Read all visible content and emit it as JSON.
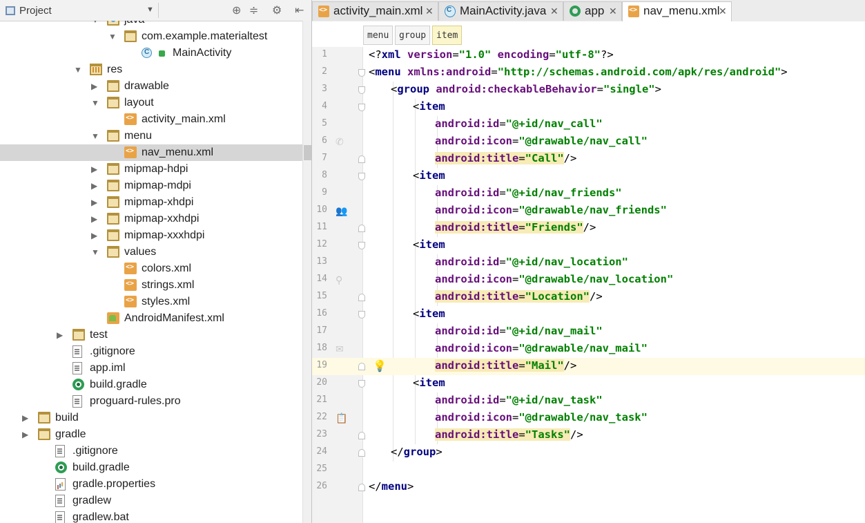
{
  "project_panel": {
    "title": "Project",
    "dropdown_glyph": "▼",
    "header_icons": [
      "⊕",
      "≑",
      "⚙",
      "⇤"
    ],
    "tree": [
      {
        "label": "java",
        "indent": 5,
        "arrow": "▼",
        "icon": "folder-src"
      },
      {
        "label": "com.example.materialtest",
        "indent": 6,
        "arrow": "▼",
        "icon": "folder"
      },
      {
        "label": "MainActivity",
        "indent": 7,
        "arrow": "",
        "icon": "class"
      },
      {
        "label": "res",
        "indent": 4,
        "arrow": "▼",
        "icon": "res"
      },
      {
        "label": "drawable",
        "indent": 5,
        "arrow": "▶",
        "icon": "folder"
      },
      {
        "label": "layout",
        "indent": 5,
        "arrow": "▼",
        "icon": "folder"
      },
      {
        "label": "activity_main.xml",
        "indent": 6,
        "arrow": "",
        "icon": "xml"
      },
      {
        "label": "menu",
        "indent": 5,
        "arrow": "▼",
        "icon": "folder"
      },
      {
        "label": "nav_menu.xml",
        "indent": 6,
        "arrow": "",
        "icon": "xml",
        "selected": true
      },
      {
        "label": "mipmap-hdpi",
        "indent": 5,
        "arrow": "▶",
        "icon": "folder"
      },
      {
        "label": "mipmap-mdpi",
        "indent": 5,
        "arrow": "▶",
        "icon": "folder"
      },
      {
        "label": "mipmap-xhdpi",
        "indent": 5,
        "arrow": "▶",
        "icon": "folder"
      },
      {
        "label": "mipmap-xxhdpi",
        "indent": 5,
        "arrow": "▶",
        "icon": "folder"
      },
      {
        "label": "mipmap-xxxhdpi",
        "indent": 5,
        "arrow": "▶",
        "icon": "folder"
      },
      {
        "label": "values",
        "indent": 5,
        "arrow": "▼",
        "icon": "folder"
      },
      {
        "label": "colors.xml",
        "indent": 6,
        "arrow": "",
        "icon": "xml"
      },
      {
        "label": "strings.xml",
        "indent": 6,
        "arrow": "",
        "icon": "xml"
      },
      {
        "label": "styles.xml",
        "indent": 6,
        "arrow": "",
        "icon": "xml"
      },
      {
        "label": "AndroidManifest.xml",
        "indent": 5,
        "arrow": "",
        "icon": "manifest"
      },
      {
        "label": "test",
        "indent": 3,
        "arrow": "▶",
        "icon": "folder"
      },
      {
        "label": ".gitignore",
        "indent": 3,
        "arrow": "",
        "icon": "file"
      },
      {
        "label": "app.iml",
        "indent": 3,
        "arrow": "",
        "icon": "file"
      },
      {
        "label": "build.gradle",
        "indent": 3,
        "arrow": "",
        "icon": "gradle"
      },
      {
        "label": "proguard-rules.pro",
        "indent": 3,
        "arrow": "",
        "icon": "file"
      },
      {
        "label": "build",
        "indent": 1,
        "arrow": "▶",
        "icon": "folder"
      },
      {
        "label": "gradle",
        "indent": 1,
        "arrow": "▶",
        "icon": "folder"
      },
      {
        "label": ".gitignore",
        "indent": 2,
        "arrow": "",
        "icon": "file"
      },
      {
        "label": "build.gradle",
        "indent": 2,
        "arrow": "",
        "icon": "gradle"
      },
      {
        "label": "gradle.properties",
        "indent": 2,
        "arrow": "",
        "icon": "props"
      },
      {
        "label": "gradlew",
        "indent": 2,
        "arrow": "",
        "icon": "file"
      },
      {
        "label": "gradlew.bat",
        "indent": 2,
        "arrow": "",
        "icon": "file"
      }
    ]
  },
  "editor": {
    "tabs": [
      {
        "label": "activity_main.xml",
        "icon": "xml",
        "active": false
      },
      {
        "label": "MainActivity.java",
        "icon": "class",
        "active": false
      },
      {
        "label": "app",
        "icon": "app",
        "active": false
      },
      {
        "label": "nav_menu.xml",
        "icon": "xml",
        "active": true
      }
    ],
    "close_glyph": "✕",
    "breadcrumbs": [
      {
        "label": "menu",
        "active": false
      },
      {
        "label": "group",
        "active": false
      },
      {
        "label": "item",
        "active": true
      }
    ],
    "current_line": 19,
    "lines": [
      {
        "n": "1",
        "indent": 0,
        "parts": [
          [
            "pi",
            "<?"
          ],
          [
            "tag",
            "xml "
          ],
          [
            "attr",
            "version"
          ],
          [
            "pi",
            "="
          ],
          [
            "val",
            "\"1.0\" "
          ],
          [
            "attr",
            "encoding"
          ],
          [
            "pi",
            "="
          ],
          [
            "val",
            "\"utf-8\""
          ],
          [
            "pi",
            "?>"
          ]
        ]
      },
      {
        "n": "2",
        "indent": 0,
        "fold": "open",
        "parts": [
          [
            "pi",
            "<"
          ],
          [
            "tag",
            "menu "
          ],
          [
            "attr",
            "xmlns:android"
          ],
          [
            "pi",
            "="
          ],
          [
            "val",
            "\"http://schemas.android.com/apk/res/android\""
          ],
          [
            "pi",
            ">"
          ]
        ]
      },
      {
        "n": "3",
        "indent": 1,
        "fold": "open",
        "parts": [
          [
            "pi",
            "<"
          ],
          [
            "tag",
            "group "
          ],
          [
            "attr",
            "android:checkableBehavior"
          ],
          [
            "pi",
            "="
          ],
          [
            "val",
            "\"single\""
          ],
          [
            "pi",
            ">"
          ]
        ]
      },
      {
        "n": "4",
        "indent": 2,
        "fold": "open",
        "parts": [
          [
            "pi",
            "<"
          ],
          [
            "tag",
            "item"
          ]
        ]
      },
      {
        "n": "5",
        "indent": 3,
        "parts": [
          [
            "attr",
            "android:id"
          ],
          [
            "pi",
            "="
          ],
          [
            "val",
            "\"@+id/nav_call\""
          ]
        ]
      },
      {
        "n": "6",
        "indent": 3,
        "gicon": "phone-icon",
        "gicon_glyph": "✆",
        "parts": [
          [
            "attr",
            "android:icon"
          ],
          [
            "pi",
            "="
          ],
          [
            "val",
            "\"@drawable/nav_call\""
          ]
        ]
      },
      {
        "n": "7",
        "indent": 3,
        "fold": "close",
        "parts": [
          [
            "attr hl",
            "android:title"
          ],
          [
            "pi hl",
            "="
          ],
          [
            "val hl",
            "\"Call\""
          ],
          [
            "pi",
            "/>"
          ]
        ]
      },
      {
        "n": "8",
        "indent": 2,
        "fold": "open",
        "parts": [
          [
            "pi",
            "<"
          ],
          [
            "tag",
            "item"
          ]
        ]
      },
      {
        "n": "9",
        "indent": 3,
        "parts": [
          [
            "attr",
            "android:id"
          ],
          [
            "pi",
            "="
          ],
          [
            "val",
            "\"@+id/nav_friends\""
          ]
        ]
      },
      {
        "n": "10",
        "indent": 3,
        "gicon": "people-icon",
        "gicon_glyph": "👥",
        "parts": [
          [
            "attr",
            "android:icon"
          ],
          [
            "pi",
            "="
          ],
          [
            "val",
            "\"@drawable/nav_friends\""
          ]
        ]
      },
      {
        "n": "11",
        "indent": 3,
        "fold": "close",
        "parts": [
          [
            "attr hl",
            "android:title"
          ],
          [
            "pi hl",
            "="
          ],
          [
            "val hl",
            "\"Friends\""
          ],
          [
            "pi",
            "/>"
          ]
        ]
      },
      {
        "n": "12",
        "indent": 2,
        "fold": "open",
        "parts": [
          [
            "pi",
            "<"
          ],
          [
            "tag",
            "item"
          ]
        ]
      },
      {
        "n": "13",
        "indent": 3,
        "parts": [
          [
            "attr",
            "android:id"
          ],
          [
            "pi",
            "="
          ],
          [
            "val",
            "\"@+id/nav_location\""
          ]
        ]
      },
      {
        "n": "14",
        "indent": 3,
        "gicon": "location-pin-icon",
        "gicon_glyph": "⚲",
        "parts": [
          [
            "attr",
            "android:icon"
          ],
          [
            "pi",
            "="
          ],
          [
            "val",
            "\"@drawable/nav_location\""
          ]
        ]
      },
      {
        "n": "15",
        "indent": 3,
        "fold": "close",
        "parts": [
          [
            "attr hl",
            "android:title"
          ],
          [
            "pi hl",
            "="
          ],
          [
            "val hl",
            "\"Location\""
          ],
          [
            "pi",
            "/>"
          ]
        ]
      },
      {
        "n": "16",
        "indent": 2,
        "fold": "open",
        "parts": [
          [
            "pi",
            "<"
          ],
          [
            "tag",
            "item"
          ]
        ]
      },
      {
        "n": "17",
        "indent": 3,
        "parts": [
          [
            "attr",
            "android:id"
          ],
          [
            "pi",
            "="
          ],
          [
            "val",
            "\"@+id/nav_mail\""
          ]
        ]
      },
      {
        "n": "18",
        "indent": 3,
        "gicon": "mail-icon",
        "gicon_glyph": "✉",
        "parts": [
          [
            "attr",
            "android:icon"
          ],
          [
            "pi",
            "="
          ],
          [
            "val",
            "\"@drawable/nav_mail\""
          ]
        ]
      },
      {
        "n": "19",
        "indent": 3,
        "fold": "close",
        "gicon": "lightbulb-icon",
        "gicon_glyph": "💡",
        "parts": [
          [
            "attr hl",
            "android:title"
          ],
          [
            "pi hl",
            "="
          ],
          [
            "val hl",
            "\"Mail\""
          ],
          [
            "pi",
            "/>"
          ]
        ]
      },
      {
        "n": "20",
        "indent": 2,
        "fold": "open",
        "parts": [
          [
            "pi",
            "<"
          ],
          [
            "tag",
            "item"
          ]
        ]
      },
      {
        "n": "21",
        "indent": 3,
        "parts": [
          [
            "attr",
            "android:id"
          ],
          [
            "pi",
            "="
          ],
          [
            "val",
            "\"@+id/nav_task\""
          ]
        ]
      },
      {
        "n": "22",
        "indent": 3,
        "gicon": "clipboard-icon",
        "gicon_glyph": "📋",
        "parts": [
          [
            "attr",
            "android:icon"
          ],
          [
            "pi",
            "="
          ],
          [
            "val",
            "\"@drawable/nav_task\""
          ]
        ]
      },
      {
        "n": "23",
        "indent": 3,
        "fold": "close",
        "parts": [
          [
            "attr hl",
            "android:title"
          ],
          [
            "pi hl",
            "="
          ],
          [
            "val hl",
            "\"Tasks\""
          ],
          [
            "pi",
            "/>"
          ]
        ]
      },
      {
        "n": "24",
        "indent": 1,
        "fold": "close",
        "parts": [
          [
            "pi",
            "</"
          ],
          [
            "tag",
            "group"
          ],
          [
            "pi",
            ">"
          ]
        ]
      },
      {
        "n": "25",
        "indent": 0,
        "parts": []
      },
      {
        "n": "26",
        "indent": 0,
        "fold": "close",
        "parts": [
          [
            "pi",
            "</"
          ],
          [
            "tag",
            "menu"
          ],
          [
            "pi",
            ">"
          ]
        ]
      }
    ]
  },
  "colors": {
    "tag": "#000080",
    "attribute": "#660e7a",
    "value": "#008000",
    "title_highlight": "#f7ebb6",
    "current_line": "#fffae3",
    "selection": "#d6d6d6"
  }
}
